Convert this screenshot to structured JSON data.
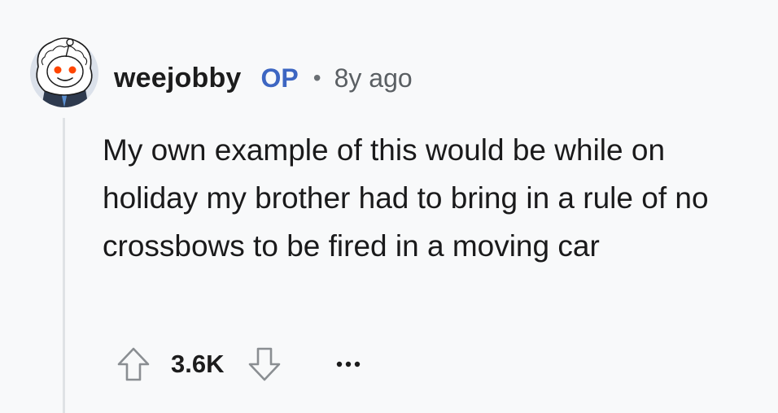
{
  "comment": {
    "author": "weejobby",
    "badge": "OP",
    "separator": "•",
    "time": "8y ago",
    "body": "My own example of this would be while on holiday my brother had to bring in a rule of no crossbows to be fired in a moving car",
    "score": "3.6K"
  },
  "icons": {
    "avatar": "snoo-avatar-icon",
    "upvote": "arrow-up-outline-icon",
    "downvote": "arrow-down-outline-icon",
    "more": "ellipsis-icon"
  },
  "colors": {
    "background": "#f8f9fa",
    "op_badge": "#3d66c2",
    "text": "#1a1a1b",
    "thread_line": "#dfe2e5",
    "avatar_bg": "#dbe1ea"
  }
}
